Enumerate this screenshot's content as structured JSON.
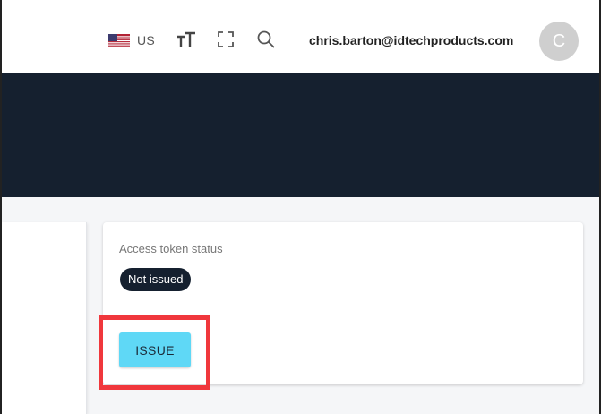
{
  "header": {
    "locale": "US",
    "user_email": "chris.barton@idtechproducts.com",
    "avatar_initial": "C",
    "icons": [
      "us-flag-icon",
      "font-size-icon",
      "fullscreen-icon",
      "search-icon"
    ]
  },
  "token_card": {
    "label": "Access token status",
    "status": "Not issued",
    "issue_button_label": "ISSUE"
  },
  "colors": {
    "hero": "#15202f",
    "badge": "#15202f",
    "button": "#5fd8f6",
    "highlight": "#f0373c",
    "avatar": "#cfcfcf"
  }
}
